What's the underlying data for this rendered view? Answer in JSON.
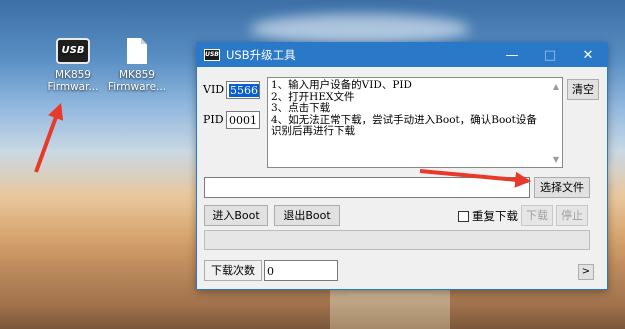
{
  "desktop": {
    "icons": [
      {
        "label": "MK859\nFirmwar...",
        "icon": "usb-tool-icon"
      },
      {
        "label": "MK859\nFirmware...",
        "icon": "file-icon"
      }
    ]
  },
  "window": {
    "title": "USB升级工具",
    "controls": {
      "minimize": "—",
      "maximize": "□",
      "close": "✕"
    }
  },
  "form": {
    "vid_label": "VID",
    "vid_value": "5566",
    "pid_label": "PID",
    "pid_value": "0001",
    "clear_button": "清空",
    "instructions": [
      "1、输入用户设备的VID、PID",
      "2、打开HEX文件",
      "3、点击下载",
      "4、如无法正常下载，尝试手动进入Boot，确认Boot设备识别后再进行下载"
    ],
    "file_path_value": "",
    "select_file_button": "选择文件",
    "enter_boot_button": "进入Boot",
    "exit_boot_button": "退出Boot",
    "repeat_download_label": "重复下载",
    "download_button": "下载",
    "stop_button": "停止",
    "progress": 0,
    "download_count_label": "下载次数",
    "download_count_value": "0",
    "expand_button": ">"
  }
}
